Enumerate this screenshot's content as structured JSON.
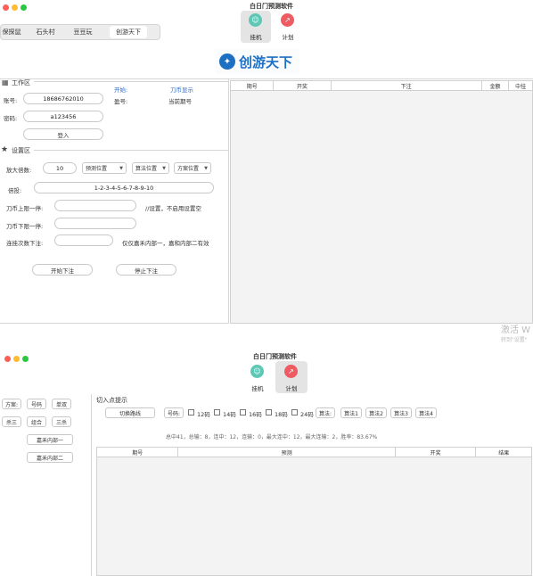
{
  "window1": {
    "title": "白日门预测软件",
    "nav_tabs": [
      "保探鼠",
      "石头村",
      "豆豆玩",
      "创游天下"
    ],
    "toolbar": {
      "hang_label": "挂机",
      "plan_label": "计划"
    },
    "logo_text": "创游天下",
    "work": {
      "title": "工作区",
      "start_label": "开始:",
      "knife_label": "刀币显示",
      "surplus_label": "盈号:",
      "current_label": "当前期号",
      "account_label": "账号:",
      "account_value": "18686762010",
      "password_label": "密码:",
      "password_value": "a123456",
      "login_label": "登入"
    },
    "settings": {
      "title": "设置区",
      "multiplier_label": "放大倍数:",
      "multiplier_value": "10",
      "select1": "预测位置",
      "select2": "算法位置",
      "select3": "方案位置",
      "multiple_label": "倍投:",
      "multiple_value": "1-2-3-4-5-6-7-8-9-10",
      "upper_label": "刀币上限一停:",
      "upper_hint": "//设置，不启用设置空",
      "lower_label": "刀币下限一停:",
      "streak_label": "连挂次数下注:",
      "streak_hint": "仅仅嘉禾内部一，嘉和内部二有效",
      "start_bet_label": "开始下注",
      "stop_bet_label": "停止下注"
    },
    "table_headers": [
      "期号",
      "开奖",
      "下注",
      "金额",
      "中挂"
    ],
    "watermark_line1": "激活 W",
    "watermark_line2": "转到\"设置\""
  },
  "window2": {
    "title": "白日门预测软件",
    "toolbar": {
      "hang_label": "挂机",
      "plan_label": "计划"
    },
    "left_buttons": [
      [
        "方案:",
        "号码",
        "单双"
      ],
      [
        "杀三",
        "组合",
        "三杀"
      ]
    ],
    "jiahe1": "嘉禾内部一",
    "jiahe2": "嘉禾内部二",
    "entry_title": "切入点提示",
    "switch_line": "切换路线",
    "code_label": "号码:",
    "codes": [
      "12码",
      "14码",
      "16码",
      "18码",
      "24码"
    ],
    "algo_label": "算法:",
    "algos": [
      "算法1",
      "算法2",
      "算法3",
      "算法4"
    ],
    "stats": "总中41，总输：8，连中：12，连输：0，最大连中：12，最大连输：2，胜率：83.67%",
    "table_headers": [
      "期号",
      "预测",
      "开奖",
      "结果"
    ]
  }
}
